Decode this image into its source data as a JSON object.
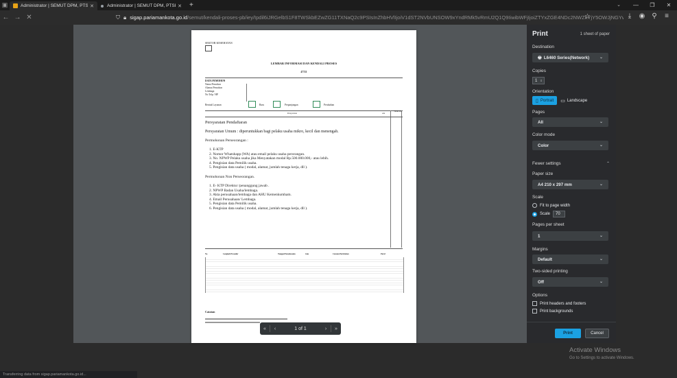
{
  "browser": {
    "tabs": [
      {
        "title": "Administrator | SEMUT DPM, PTSP",
        "active": true
      },
      {
        "title": "Administrator | SEMUT DPM, PTSP",
        "active": false
      }
    ],
    "url_host": "sigap.pariamankota.go.id",
    "url_path": "/semut/kendali-proses-pb/iey/Ipdil6iJRGelbS1F8TWSkbEZwZG11TXNaQ2c9PSIsInZhbHVlIjoiV1dST2NVbUNSOW9xYndRMk5vRmU2Q1Q9IiwibWFjIjoiZTYxZGE4NDc2NWZkYjY5OWJjNGYwMDlzMWI",
    "status_text": "Transferring data from sigap.pariamankota.go.id...",
    "icons": {
      "back": "arrow-left-icon",
      "forward": "arrow-right-icon",
      "stop": "close-icon",
      "bookmark": "star-icon",
      "download": "download-icon",
      "profile": "profile-icon",
      "extensions": "extensions-icon"
    }
  },
  "document": {
    "header_small": "SEKTOR KESEHATAN",
    "title": "LEMBAR INFORMASI DAN KENDALI PROSES",
    "number": "47721",
    "section_pemohon": "DATA PEMOHON",
    "fields": [
      "Nama Pemohon",
      "Alamat Pemohon",
      "Lembaga",
      "No Telp / HP",
      "Bentuk Layanan"
    ],
    "layanan_options": [
      "Baru",
      "Perpanjangan",
      "Perubahan"
    ],
    "table_head": [
      "Persyaratan",
      "ada",
      "Tidak ada"
    ],
    "para1": "Persyaratan Pendaftaran",
    "para2": "Persyaratan Umum : diperuntukkan bagi pelaku usaha mikro, kecil dan menengah.",
    "para3": "Permohonan Perseorangan :",
    "list1": [
      "1. E-KTP",
      "2. Nomor Whatshapp (WA)  atau email pelaku usaha perorangan.",
      "3. No. NPWP Pelaku usaha jika Menyatakan modal Rp.500.000.000,- atau lebih.",
      "4. Pengisian data Pemilik usaha.",
      "5. Pengisian data usaha ( modal, alamat, jumlah tenaga kerja, dll )."
    ],
    "para4": "Permohonan Non Perseorangan.",
    "list2": [
      "1. E- KTP Direktur /penanggung jawab .",
      "2. NPWP Badan Usaha/lembaga.",
      "3. Akta perusahaan/lembaga dan AHU Kemenkumham.",
      "4. Email Perusahaan/ Lembaga.",
      "5. Pengisian data Pemilik usaha.",
      "6. Pengisian data usaha ( modal, alamat, jumlah tenaga kerja, dll )."
    ],
    "t2_head": [
      "No",
      "Langkah Prosedur",
      "Tanggal Penyelesaian",
      "Jam",
      "Catatan Perubahan",
      "Paraf"
    ],
    "catatan": "Catatan"
  },
  "pager": {
    "prev_all": "«",
    "prev": "‹",
    "page": "1 of 1",
    "next": "›",
    "next_all": "»"
  },
  "print": {
    "title": "Print",
    "sheets": "1 sheet of paper",
    "destination_label": "Destination",
    "destination_value": "L6460 Series(Network)",
    "copies_label": "Copies",
    "copies_value": "1",
    "orientation_label": "Orientation",
    "portrait": "Portrait",
    "landscape": "Landscape",
    "pages_label": "Pages",
    "pages_value": "All",
    "color_label": "Color mode",
    "color_value": "Color",
    "fewer_settings": "Fewer settings",
    "paper_label": "Paper size",
    "paper_value": "A4 210 x 297 mm",
    "scale_label": "Scale",
    "fit_option": "Fit to page width",
    "scale_option": "Scale",
    "scale_value": "70",
    "pps_label": "Pages per sheet",
    "pps_value": "1",
    "margins_label": "Margins",
    "margins_value": "Default",
    "twosided_label": "Two-sided printing",
    "twosided_value": "Off",
    "options_label": "Options",
    "opt_headers": "Print headers and footers",
    "opt_backgrounds": "Print backgrounds",
    "print_btn": "Print",
    "cancel_btn": "Cancel",
    "accent": "#1ba1e2"
  },
  "watermark": {
    "line1": "Activate Windows",
    "line2": "Go to Settings to activate Windows."
  }
}
